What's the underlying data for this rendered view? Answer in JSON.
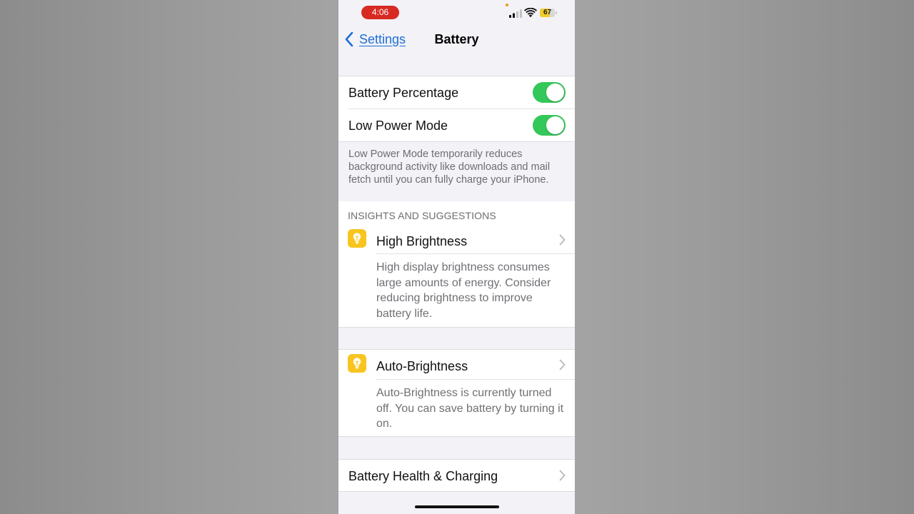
{
  "status_bar": {
    "time": "4:06",
    "battery_level": "67",
    "battery_fraction": 0.67,
    "icons": [
      "cellular-signal-icon",
      "wifi-icon",
      "battery-icon"
    ]
  },
  "nav": {
    "back_label": "Settings",
    "title": "Battery"
  },
  "toggles": [
    {
      "label": "Battery Percentage",
      "on": true
    },
    {
      "label": "Low Power Mode",
      "on": true
    }
  ],
  "low_power_footnote": "Low Power Mode temporarily reduces background activity like downloads and mail fetch until you can fully charge your iPhone.",
  "insights": {
    "header": "INSIGHTS AND SUGGESTIONS",
    "items": [
      {
        "title": "High Brightness",
        "description": "High display brightness consumes large amounts of energy. Consider reducing brightness to improve battery life.",
        "icon": "lightbulb-icon"
      },
      {
        "title": "Auto-Brightness",
        "description": "Auto-Brightness is currently turned off. You can save battery by turning it on.",
        "icon": "lightbulb-icon"
      }
    ]
  },
  "battery_health": {
    "label": "Battery Health & Charging"
  },
  "colors": {
    "toggle_on": "#34c759",
    "link_blue": "#1f6fd6",
    "insight_icon": "#f7c51e",
    "time_pill": "#d72a22"
  }
}
